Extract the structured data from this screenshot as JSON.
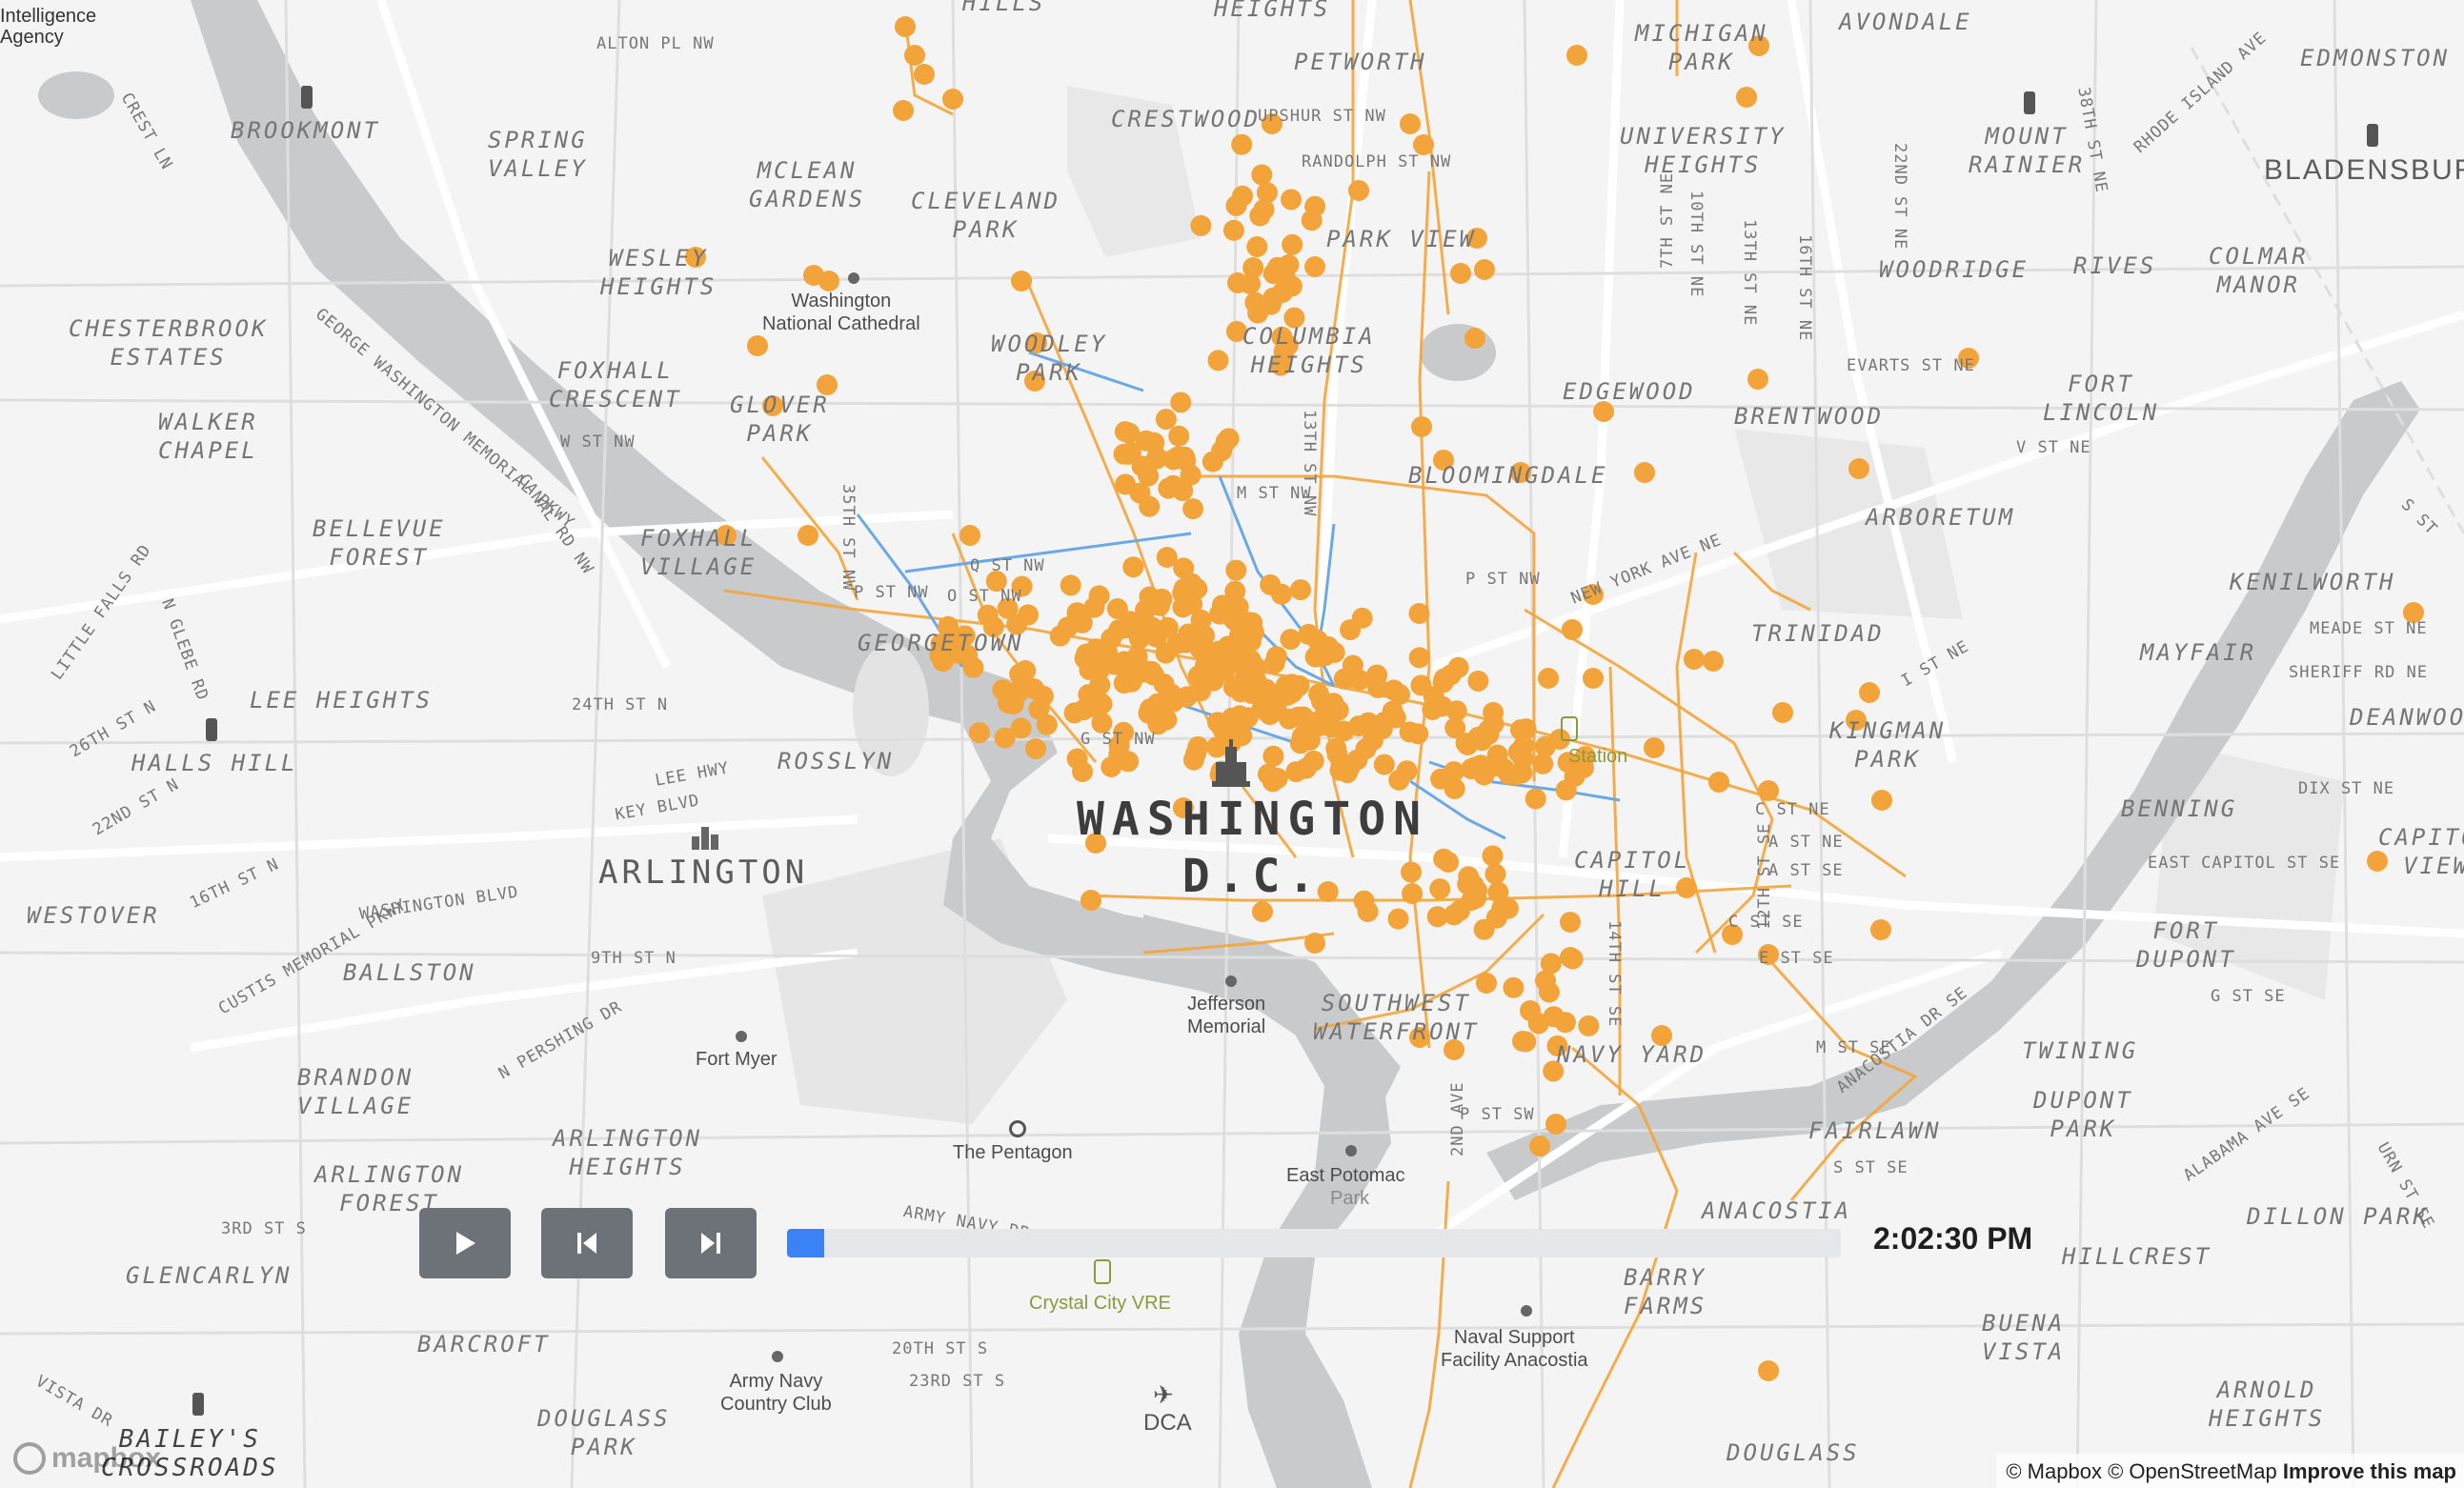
{
  "map": {
    "colors": {
      "land": "#f4f4f4",
      "water": "#c9cacc",
      "park": "#e7e7e7",
      "road": "#ffffff",
      "road_minor": "#dcdcdc",
      "route_orange": "#f3a53a",
      "route_blue": "#6aa8e6",
      "stop": "#f2a33a"
    },
    "labels": {
      "cia": "Intelligence\nAgency",
      "brookmont": "BROOKMONT",
      "spring_valley": "SPRING\nVALLEY",
      "mclean_gardens": "MCLEAN\nGARDENS",
      "cleveland_park": "CLEVELAND\nPARK",
      "crestwood": "CRESTWOOD",
      "petworth": "PETWORTH",
      "heights_top": "HEIGHTS",
      "hills_top": "HILLS",
      "michigan_park": "MICHIGAN\nPARK",
      "avondale": "AVONDALE",
      "edmonston": "EDMONSTON",
      "university_heights": "UNIVERSITY\nHEIGHTS",
      "mount_rainier": "MOUNT\nRAINIER",
      "bladensburg": "BLADENSBURG",
      "wesley_heights": "WESLEY\nHEIGHTS",
      "national_cathedral": "Washington\nNational Cathedral",
      "park_view": "PARK VIEW",
      "woodridge": "WOODRIDGE",
      "rives": "RIVES",
      "colmar_manor": "COLMAR\nMANOR",
      "chesterbrook": "CHESTERBROOK\nESTATES",
      "foxhall_crescent": "FOXHALL\nCRESCENT",
      "woodley_park": "WOODLEY\nPARK",
      "columbia_heights": "COLUMBIA\nHEIGHTS",
      "glover_park": "GLOVER\nPARK",
      "edgewood": "EDGEWOOD",
      "brentwood": "BRENTWOOD",
      "fort_lincoln": "FORT\nLINCOLN",
      "walker_chapel": "WALKER\nCHAPEL",
      "bloomingdale": "BLOOMINGDALE",
      "arboretum": "ARBORETUM",
      "bellevue_forest": "BELLEVUE\nFOREST",
      "foxhall_village": "FOXHALL\nVILLAGE",
      "kenilworth": "KENILWORTH",
      "trinidad": "TRINIDAD",
      "mayfair": "MAYFAIR",
      "lee_heights": "LEE HEIGHTS",
      "georgetown": "GEORGETOWN",
      "kingman_park": "KINGMAN\nPARK",
      "deanwood": "DEANWOOD",
      "halls_hill": "HALLS HILL",
      "rosslyn": "ROSSLYN",
      "benning": "BENNING",
      "washington_dc": "WASHINGTON\nD.C.",
      "arlington": "ARLINGTON",
      "capitol_hill": "CAPITOL\nHILL",
      "capitol_view": "CAPITOL\nVIEW",
      "westover": "WESTOVER",
      "fort_dupont": "FORT\nDUPONT",
      "ballston": "BALLSTON",
      "jefferson_memorial": "Jefferson\nMemorial",
      "southwest_waterfront": "SOUTHWEST\nWATERFRONT",
      "navy_yard": "NAVY YARD",
      "twining": "TWINING",
      "dupont_park": "DUPONT\nPARK",
      "fort_myer": "Fort Myer",
      "brandon_village": "BRANDON\nVILLAGE",
      "fairlawn": "FAIRLAWN",
      "arlington_heights": "ARLINGTON\nHEIGHTS",
      "the_pentagon": "The Pentagon",
      "east_potomac": "East Potomac",
      "east_potomac_park": "Park",
      "anacostia": "ANACOSTIA",
      "dillon_park": "DILLON PARK",
      "arlington_forest": "ARLINGTON\nFOREST",
      "glencarlyn": "GLENCARLYN",
      "hillcrest": "HILLCREST",
      "crystal_city_vre": "Crystal City VRE",
      "barry_farms": "BARRY\nFARMS",
      "naval_support": "Naval Support\nFacility Anacostia",
      "buena_vista": "BUENA\nVISTA",
      "barcroft": "BARCROFT",
      "army_navy_cc": "Army Navy\nCountry Club",
      "arnold_heights": "ARNOLD\nHEIGHTS",
      "dca": "DCA",
      "douglass_park": "DOUGLASS\nPARK",
      "baileys_crossroads": "BAILEY'S\nCROSSROADS",
      "douglass": "DOUGLASS",
      "union_station": "Station"
    },
    "streets": {
      "alton_pl": "ALTON PL NW",
      "upshur": "UPSHUR ST NW",
      "randolph": "RANDOLPH ST NW",
      "s38th": "38TH ST NE",
      "rhode_island": "RHODE ISLAND AVE",
      "s22nd": "22ND ST NE",
      "s10th": "10TH ST NE",
      "s13th": "13TH ST NE",
      "s16th": "16TH ST NE",
      "s7th": "7TH ST NE",
      "evarts": "EVARTS ST NE",
      "crest_ln": "CREST LN",
      "gw_pkwy": "GEORGE WASHINGTON MEMORIAL PKWY",
      "canal_rd": "CANAL RD NW",
      "w_st": "W ST NW",
      "v_st": "V ST NE",
      "s_st": "S ST",
      "ny_ave": "NEW YORK AVE NE",
      "p_st_nw": "P ST NW",
      "q_st": "Q ST NW",
      "o_st": "O ST NW",
      "s35th": "35TH ST NW",
      "n13th": "13TH ST NW",
      "m_st": "M ST NW",
      "meade": "MEADE ST NE",
      "sheriff": "SHERIFF RD NE",
      "little_falls": "LITTLE FALLS RD",
      "n_glebe": "N GLEBE RD",
      "s24th": "24TH ST N",
      "lee_hwy": "LEE HWY",
      "key_blvd": "KEY BLVD",
      "i_st": "I ST NE",
      "dix": "DIX ST NE",
      "s26th": "26TH ST N",
      "s22nd_n": "22ND ST N",
      "g_st": "G ST NW",
      "c_st_ne": "C ST NE",
      "a_st_ne": "A ST NE",
      "a_st_se": "A ST SE",
      "e_cap": "EAST CAPITOL ST SE",
      "s16th_n": "16TH ST N",
      "wash_blvd": "WASHINGTON BLVD",
      "custis": "CUSTIS MEMORIAL PKWY",
      "s9th": "9TH ST N",
      "c_st_se": "C ST SE",
      "e_st_se": "E ST SE",
      "g_st_se": "G ST SE",
      "s14th_se": "14TH ST SE",
      "s12th_se": "12TH ST SE",
      "n_pershing": "N PERSHING DR",
      "m_st_se": "M ST SE",
      "anacostia_dr": "ANACOSTIA DR SE",
      "alabama": "ALABAMA AVE SE",
      "p_st_sw": "P ST SW",
      "s_st_se": "S ST SE",
      "army_navy_dr": "ARMY NAVY DR",
      "s2nd_ave": "2ND AVE",
      "s20th": "20TH ST S",
      "s23rd": "23RD ST S",
      "s3rd": "3RD ST S",
      "vista_dr": "VISTA DR",
      "urn_st": "URN ST SE"
    }
  },
  "controls": {
    "play_label": "play",
    "prev_label": "step back",
    "next_label": "step forward",
    "time": "2:02:30 PM",
    "progress": 0.035
  },
  "attribution": {
    "mapbox": "© Mapbox",
    "osm": "© OpenStreetMap",
    "improve": "Improve this map",
    "logo": "mapbox"
  }
}
